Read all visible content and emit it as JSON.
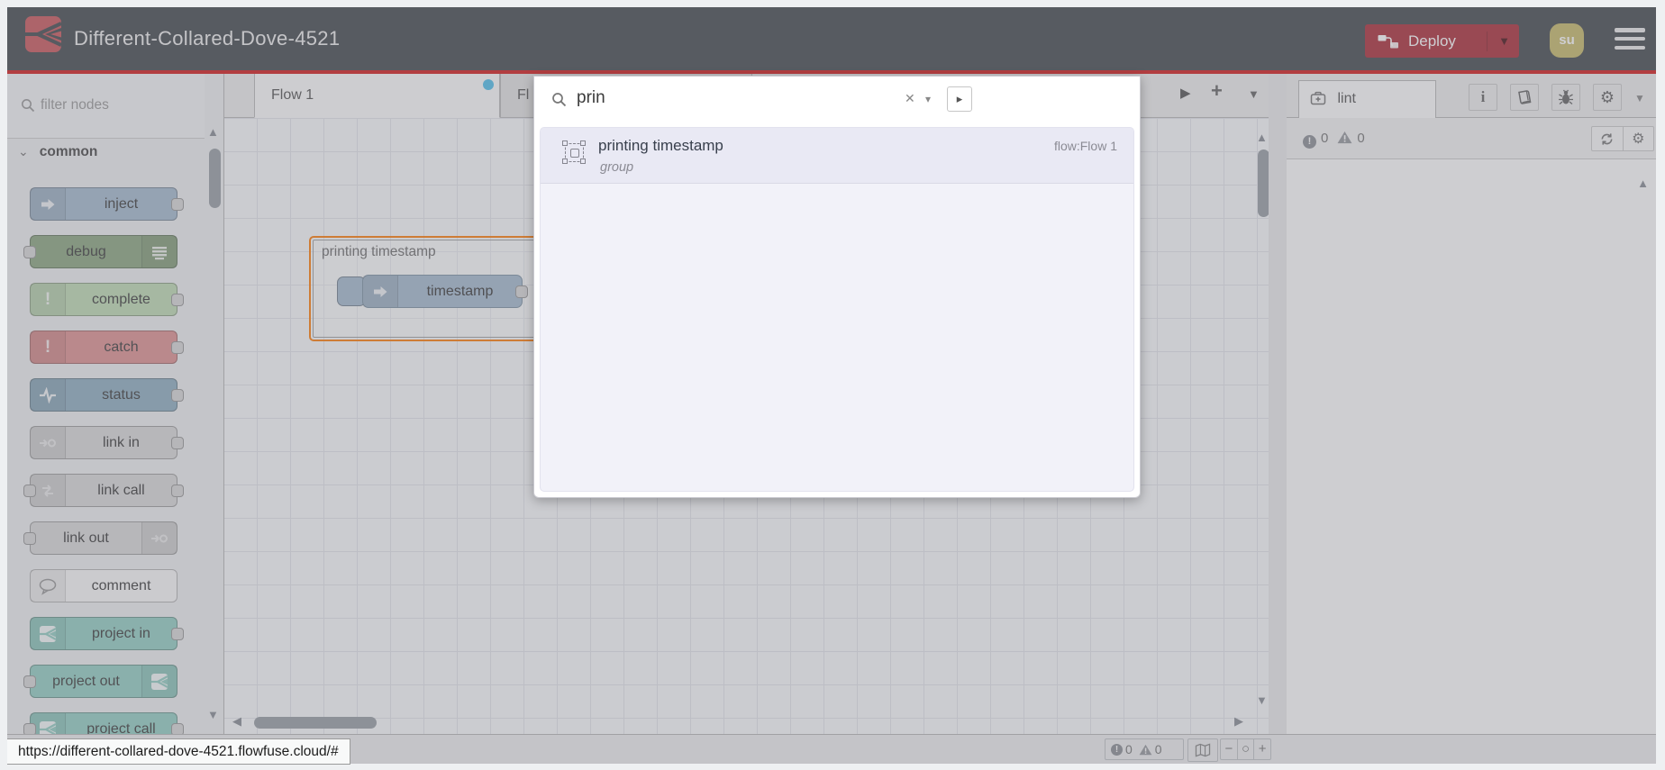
{
  "header": {
    "title": "Different-Collared-Dove-4521",
    "deploy": {
      "label": "Deploy"
    },
    "avatar": {
      "initials": "su"
    }
  },
  "palette": {
    "filter_placeholder": "filter nodes",
    "category": {
      "label": "common"
    },
    "nodes": [
      {
        "label": "inject"
      },
      {
        "label": "debug"
      },
      {
        "label": "complete"
      },
      {
        "label": "catch"
      },
      {
        "label": "status"
      },
      {
        "label": "link in"
      },
      {
        "label": "link call"
      },
      {
        "label": "link out"
      },
      {
        "label": "comment"
      },
      {
        "label": "project in"
      },
      {
        "label": "project out"
      },
      {
        "label": "project call"
      }
    ]
  },
  "workspace": {
    "tabs": [
      {
        "label": "Flow 1",
        "unsaved": true
      },
      {
        "label": "Fl"
      }
    ],
    "group": {
      "label": "printing timestamp"
    },
    "node": {
      "label": "timestamp"
    }
  },
  "search": {
    "query": "prin",
    "results": [
      {
        "title": "printing timestamp",
        "flow": "flow:Flow 1",
        "kind": "group"
      }
    ]
  },
  "sidebar": {
    "tab": {
      "label": "lint"
    },
    "status": {
      "errors": "0",
      "warnings": "0"
    }
  },
  "footer": {
    "status": {
      "errors": "0",
      "warnings": "0"
    },
    "url": "https://different-collared-dove-4521.flowfuse.cloud/#"
  },
  "icons": {
    "tab_next": "▶",
    "tab_add": "+",
    "tab_list": "▼",
    "clear": "✕",
    "caret_down": "▾",
    "options": "▸",
    "scroll_up": "▲",
    "scroll_down": "▼",
    "scroll_left": "◀",
    "scroll_right": "▶",
    "category_chevron": "⌄",
    "sidebar_caret": "▼",
    "deploy_caret": "▼",
    "gear": "⚙",
    "info": "i",
    "exclamation": "!",
    "zoom_out": "−",
    "zoom_reset": "○",
    "zoom_in": "+"
  },
  "colors": {
    "accent_red": "#d41f1f",
    "deploy_red": "#ac2f3a",
    "unsaved_dot_blue": "#54c1ed",
    "group_orange": "#ff7f0e",
    "project_teal": "#95d1c5",
    "logo_red": "#cb5a5e",
    "header_dark": "#464b51"
  }
}
